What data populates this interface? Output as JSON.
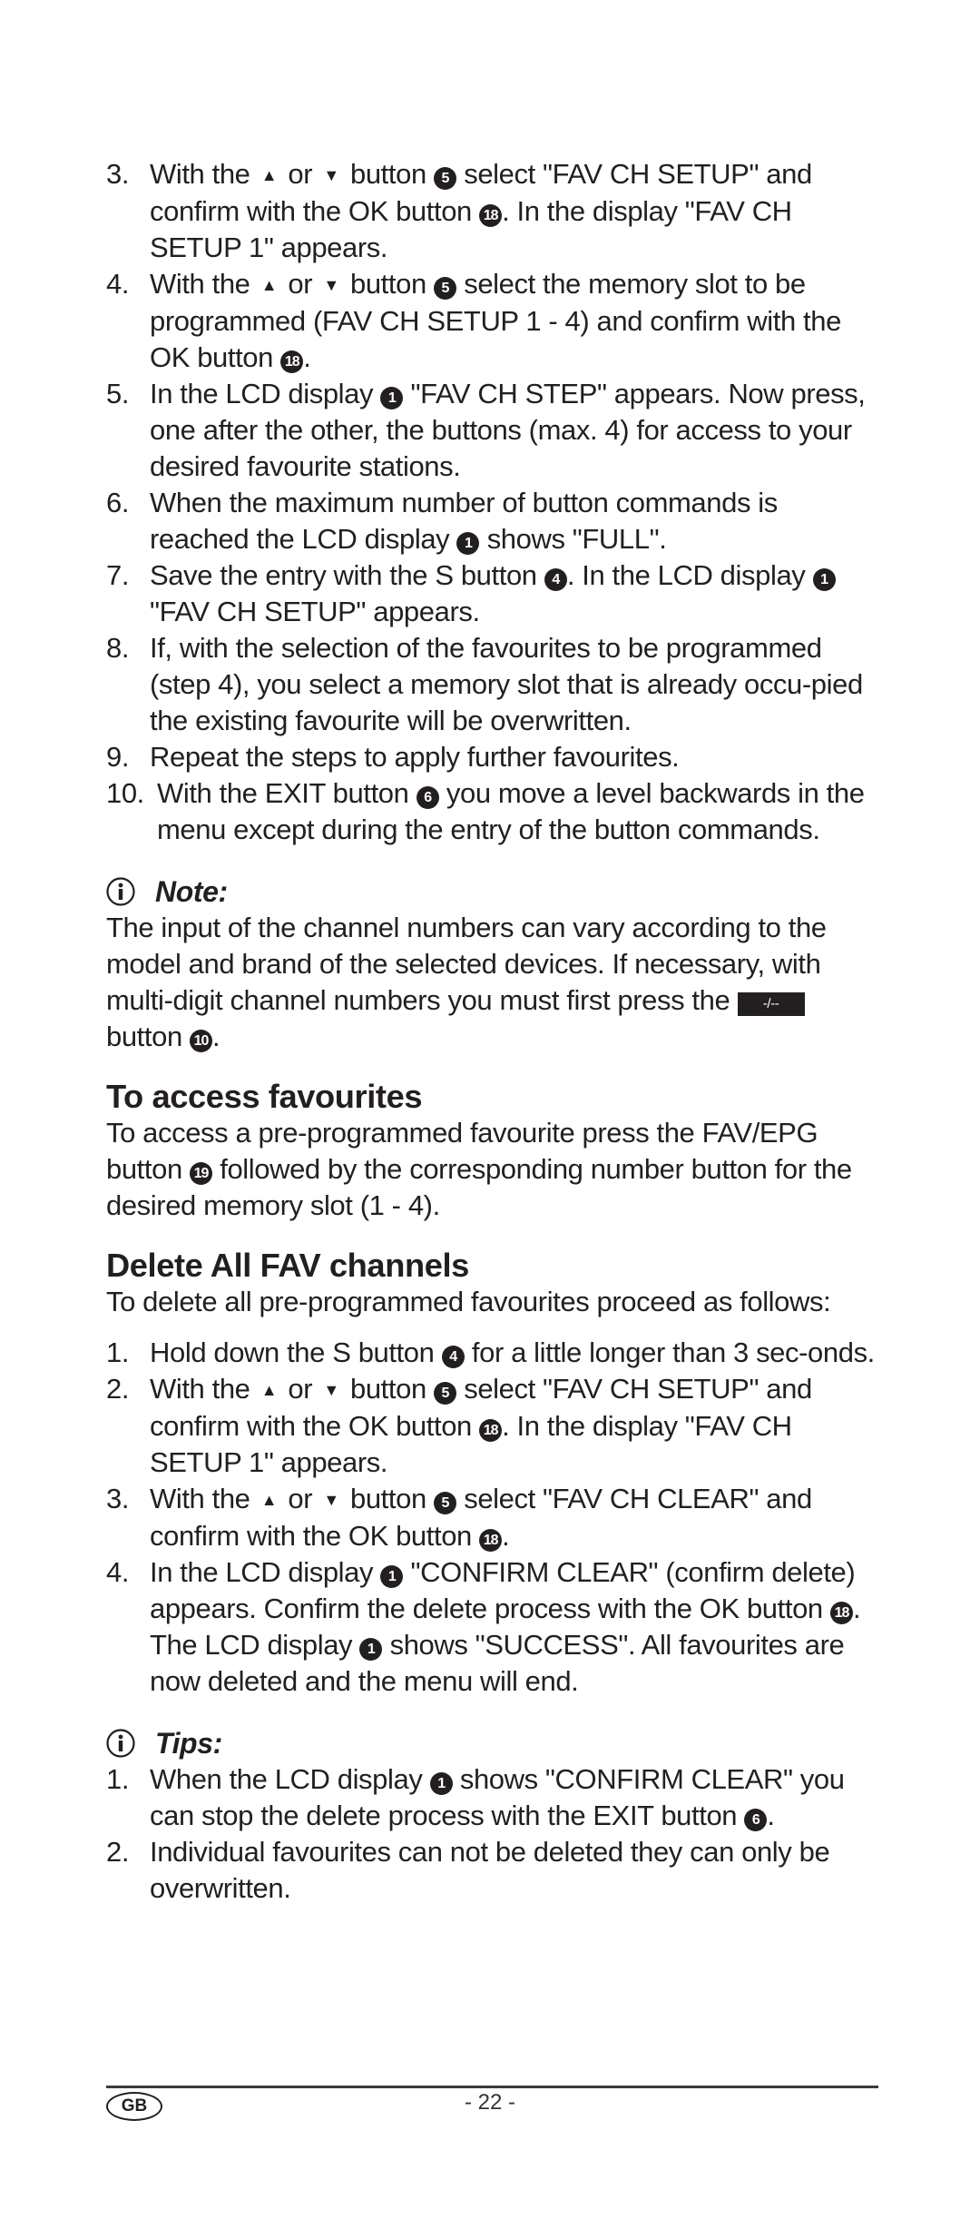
{
  "page": {
    "setup_steps": [
      {
        "num": "3.",
        "segments": [
          {
            "t": "text",
            "v": "With the "
          },
          {
            "t": "arrow",
            "v": "▲"
          },
          {
            "t": "text",
            "v": " or "
          },
          {
            "t": "arrow",
            "v": "▼"
          },
          {
            "t": "text",
            "v": " button "
          },
          {
            "t": "circ",
            "v": "5"
          },
          {
            "t": "text",
            "v": " select \"FAV CH SETUP\" and confirm with the OK button "
          },
          {
            "t": "circ",
            "v": "18"
          },
          {
            "t": "text",
            "v": ". In the display \"FAV CH SETUP 1\" appears."
          }
        ]
      },
      {
        "num": "4.",
        "segments": [
          {
            "t": "text",
            "v": "With the "
          },
          {
            "t": "arrow",
            "v": "▲"
          },
          {
            "t": "text",
            "v": " or "
          },
          {
            "t": "arrow",
            "v": "▼"
          },
          {
            "t": "text",
            "v": " button "
          },
          {
            "t": "circ",
            "v": "5"
          },
          {
            "t": "text",
            "v": " select the memory slot to be programmed (FAV CH SETUP 1 - 4) and confirm with the OK button "
          },
          {
            "t": "circ",
            "v": "18"
          },
          {
            "t": "text",
            "v": "."
          }
        ]
      },
      {
        "num": "5.",
        "segments": [
          {
            "t": "text",
            "v": "In the LCD display "
          },
          {
            "t": "circ",
            "v": "1"
          },
          {
            "t": "text",
            "v": " \"FAV CH STEP\" appears. Now press, one after the other, the buttons (max. 4) for access to your desired favourite stations."
          }
        ]
      },
      {
        "num": "6.",
        "segments": [
          {
            "t": "text",
            "v": "When the maximum number of button commands is reached the LCD display "
          },
          {
            "t": "circ",
            "v": "1"
          },
          {
            "t": "text",
            "v": " shows \"FULL\"."
          }
        ]
      },
      {
        "num": "7.",
        "segments": [
          {
            "t": "text",
            "v": "Save the entry with the S button "
          },
          {
            "t": "circ",
            "v": "4"
          },
          {
            "t": "text",
            "v": ".  In the LCD display "
          },
          {
            "t": "circ",
            "v": "1"
          },
          {
            "t": "text",
            "v": " \"FAV CH SETUP\" appears."
          }
        ]
      },
      {
        "num": "8.",
        "segments": [
          {
            "t": "text",
            "v": "If, with the selection of the favourites to be programmed (step 4), you select a memory slot that is already occu-pied the existing favourite will be overwritten."
          }
        ]
      },
      {
        "num": "9.",
        "segments": [
          {
            "t": "text",
            "v": "Repeat the steps to apply further favourites."
          }
        ]
      },
      {
        "num": "10.",
        "segments": [
          {
            "t": "text",
            "v": "With the EXIT button "
          },
          {
            "t": "circ",
            "v": "6"
          },
          {
            "t": "text",
            "v": " you move a level backwards in the menu except during the entry of the button commands."
          }
        ]
      }
    ],
    "note": {
      "icon": "info-icon",
      "label": "Note:",
      "segments": [
        {
          "t": "text",
          "v": "The input of the channel numbers can vary according to the model and brand of the selected devices. If necessary, with multi-digit channel numbers you must first press the "
        },
        {
          "t": "key",
          "v": "-/--"
        },
        {
          "t": "text",
          "v": " button "
        },
        {
          "t": "circ",
          "v": "10"
        },
        {
          "t": "text",
          "v": "."
        }
      ]
    },
    "access": {
      "heading": "To access favourites",
      "segments": [
        {
          "t": "text",
          "v": "To access a pre-programmed favourite press the FAV/EPG button "
        },
        {
          "t": "circ",
          "v": "19"
        },
        {
          "t": "text",
          "v": " followed by the corresponding number button for the desired memory slot (1 - 4)."
        }
      ]
    },
    "delete": {
      "heading": "Delete All FAV channels",
      "intro": "To delete all pre-programmed favourites proceed as follows:",
      "steps": [
        {
          "num": "1.",
          "segments": [
            {
              "t": "text",
              "v": "Hold down the S button "
            },
            {
              "t": "circ",
              "v": "4"
            },
            {
              "t": "text",
              "v": " for a little longer than 3 sec-onds."
            }
          ]
        },
        {
          "num": "2.",
          "segments": [
            {
              "t": "text",
              "v": "With the "
            },
            {
              "t": "arrow",
              "v": "▲"
            },
            {
              "t": "text",
              "v": " or "
            },
            {
              "t": "arrow",
              "v": "▼"
            },
            {
              "t": "text",
              "v": " button "
            },
            {
              "t": "circ",
              "v": "5"
            },
            {
              "t": "text",
              "v": " select \"FAV CH SETUP\" and confirm with the OK button "
            },
            {
              "t": "circ",
              "v": "18"
            },
            {
              "t": "text",
              "v": ". In the display \"FAV CH SETUP 1\" appears."
            }
          ]
        },
        {
          "num": "3.",
          "segments": [
            {
              "t": "text",
              "v": "With the "
            },
            {
              "t": "arrow",
              "v": "▲"
            },
            {
              "t": "text",
              "v": " or "
            },
            {
              "t": "arrow",
              "v": "▼"
            },
            {
              "t": "text",
              "v": " button "
            },
            {
              "t": "circ",
              "v": "5"
            },
            {
              "t": "text",
              "v": " select \"FAV CH CLEAR\" and confirm with the OK button "
            },
            {
              "t": "circ",
              "v": "18"
            },
            {
              "t": "text",
              "v": "."
            }
          ]
        },
        {
          "num": "4.",
          "segments": [
            {
              "t": "text",
              "v": "In the LCD display "
            },
            {
              "t": "circ",
              "v": "1"
            },
            {
              "t": "text",
              "v": " \"CONFIRM CLEAR\" (confirm delete) appears. Confirm the delete process with the OK button "
            },
            {
              "t": "circ",
              "v": "18"
            },
            {
              "t": "text",
              "v": ". The LCD display "
            },
            {
              "t": "circ",
              "v": "1"
            },
            {
              "t": "text",
              "v": " shows \"SUCCESS\". All favourites are now deleted and the menu will end."
            }
          ]
        }
      ]
    },
    "tips": {
      "icon": "info-icon",
      "label": "Tips:",
      "items": [
        {
          "num": "1.",
          "segments": [
            {
              "t": "text",
              "v": "When the LCD display "
            },
            {
              "t": "circ",
              "v": "1"
            },
            {
              "t": "text",
              "v": " shows \"CONFIRM CLEAR\" you can stop the delete process with the EXIT button "
            },
            {
              "t": "circ",
              "v": "6"
            },
            {
              "t": "text",
              "v": "."
            }
          ]
        },
        {
          "num": "2.",
          "segments": [
            {
              "t": "text",
              "v": "Individual favourites can not be deleted they can only be overwritten."
            }
          ]
        }
      ]
    }
  },
  "footer": {
    "country_badge": "GB",
    "page_number": "- 22 -"
  }
}
